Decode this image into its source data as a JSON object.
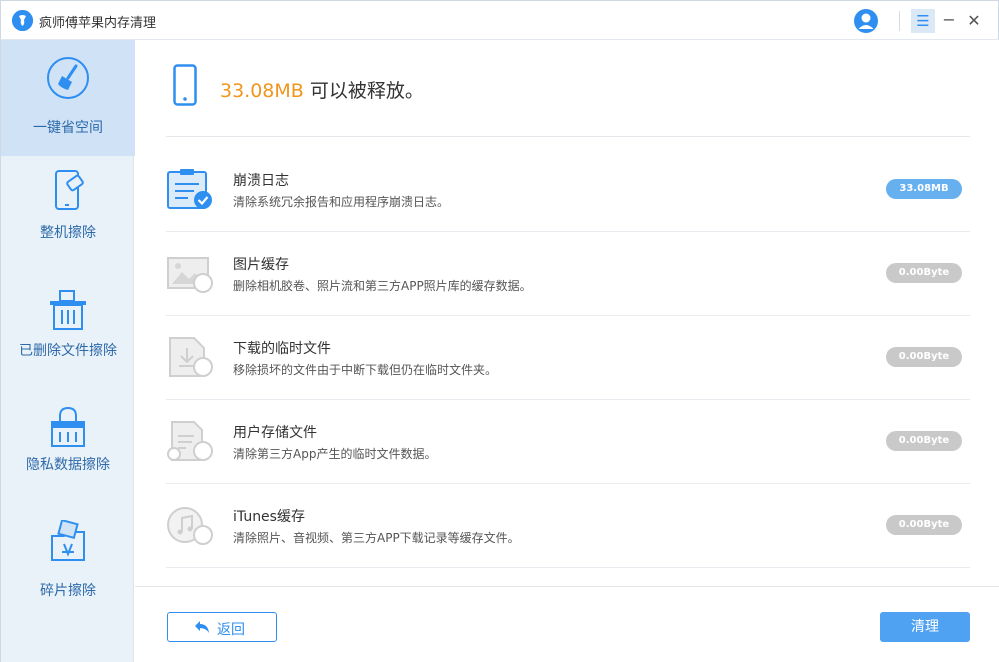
{
  "titlebar": {
    "title": "疯师傅苹果内存清理",
    "logo_icon": "app-logo-icon",
    "user_icon": "user-avatar-icon",
    "menu_icon": "menu-icon",
    "minimize": "−",
    "close": "✕",
    "menu_glyph": "☰"
  },
  "sidebar": {
    "items": [
      {
        "label": "一键省空间",
        "icon": "broom-icon",
        "active": true
      },
      {
        "label": "整机擦除",
        "icon": "phone-erase-icon",
        "active": false
      },
      {
        "label": "已删除文件擦除",
        "icon": "trash-icon",
        "active": false
      },
      {
        "label": "隐私数据擦除",
        "icon": "lock-icon",
        "active": false
      },
      {
        "label": "碎片擦除",
        "icon": "folder-shred-icon",
        "active": false
      }
    ]
  },
  "header": {
    "size": "33.08MB",
    "text": " 可以被释放。",
    "icon": "phone-icon"
  },
  "items": [
    {
      "title": "崩溃日志",
      "desc": "清除系统冗余报告和应用程序崩溃日志。",
      "badge": "33.08MB",
      "icon": "crash-log-icon",
      "active": true
    },
    {
      "title": "图片缓存",
      "desc": "删除相机胶卷、照片流和第三方APP照片库的缓存数据。",
      "badge": "0.00Byte",
      "icon": "image-cache-icon",
      "active": false
    },
    {
      "title": "下载的临时文件",
      "desc": "移除损坏的文件由于中断下载但仍在临时文件夹。",
      "badge": "0.00Byte",
      "icon": "download-temp-icon",
      "active": false
    },
    {
      "title": "用户存储文件",
      "desc": "清除第三方App产生的临时文件数据。",
      "badge": "0.00Byte",
      "icon": "user-storage-icon",
      "active": false
    },
    {
      "title": "iTunes缓存",
      "desc": "清除照片、音视频、第三方APP下载记录等缓存文件。",
      "badge": "0.00Byte",
      "icon": "itunes-cache-icon",
      "active": false
    }
  ],
  "footer": {
    "back_label": "返回",
    "clean_label": "清理"
  },
  "colors": {
    "accent": "#2e8ff0",
    "size_highlight": "#f0961e",
    "badge_active": "#67b0f0",
    "badge_inactive": "#c9c9c9",
    "sidebar_bg": "#e9f1f9",
    "sidebar_active": "#cfe2f6"
  }
}
